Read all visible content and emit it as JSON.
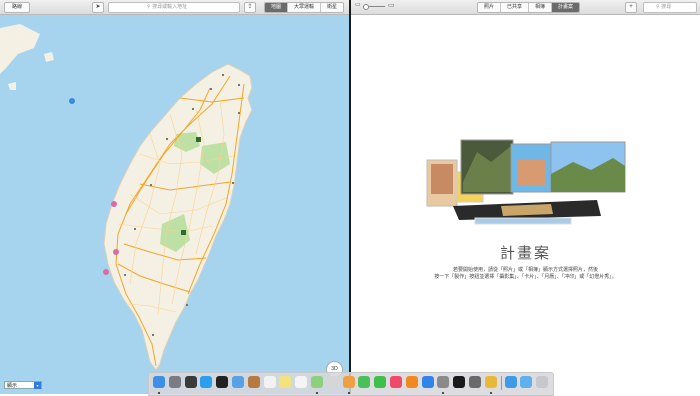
{
  "maps": {
    "directions_label": "路線",
    "search_placeholder": "搜尋或輸入地址",
    "map_types": [
      "地圖",
      "大眾運輸",
      "衛星"
    ],
    "active_map_type": "地圖",
    "compass_label": "3D",
    "display_select": "顯示"
  },
  "photos": {
    "tabs": [
      "照片",
      "已共享",
      "相簿",
      "計畫案"
    ],
    "active_tab": "計畫案",
    "search_placeholder": "搜尋",
    "projects_title": "計畫案",
    "line1": "若要開始使用，請從「照片」或「相簿」顯示方式選擇照片，然後",
    "line2": "按一下「製作」按鈕並選擇「攝影集」、「卡片」、「月曆」、「冲印」或「幻燈片秀」。"
  },
  "dock": {
    "apps": [
      {
        "icon": "finder-icon",
        "color": "#3d8fe8",
        "running": true
      },
      {
        "icon": "launchpad-icon",
        "color": "#7b7b82",
        "running": false
      },
      {
        "icon": "mission-control-icon",
        "color": "#3a3a3a",
        "running": false
      },
      {
        "icon": "safari-icon",
        "color": "#2b9ef0",
        "running": false
      },
      {
        "icon": "photo-booth-icon",
        "color": "#222222",
        "running": false
      },
      {
        "icon": "mail-icon",
        "color": "#5aa0e6",
        "running": false
      },
      {
        "icon": "contacts-icon",
        "color": "#b77a3e",
        "running": false
      },
      {
        "icon": "calendar-icon",
        "color": "#f2f2f2",
        "running": false
      },
      {
        "icon": "notes-icon",
        "color": "#f6e27a",
        "running": false
      },
      {
        "icon": "reminders-icon",
        "color": "#f4f4f4",
        "running": false
      },
      {
        "icon": "maps-icon",
        "color": "#8dcf7a",
        "running": true
      },
      {
        "icon": "script-editor-icon",
        "color": "#d6d6d6",
        "running": false
      },
      {
        "icon": "photos-icon",
        "color": "#f0a040",
        "running": true
      },
      {
        "icon": "messages-icon",
        "color": "#4bbf5a",
        "running": false
      },
      {
        "icon": "facetime-icon",
        "color": "#3dbf4a",
        "running": false
      },
      {
        "icon": "itunes-icon",
        "color": "#f04a6a",
        "running": false
      },
      {
        "icon": "ibooks-icon",
        "color": "#f08a20",
        "running": false
      },
      {
        "icon": "app-store-icon",
        "color": "#2f86e8",
        "running": false
      },
      {
        "icon": "system-preferences-icon",
        "color": "#8a8a8a",
        "running": true
      },
      {
        "icon": "terminal-icon",
        "color": "#1a1a1a",
        "running": false
      },
      {
        "icon": "preview-icon",
        "color": "#6a6a6a",
        "running": false
      },
      {
        "icon": "chrome-icon",
        "color": "#e8b838",
        "running": true
      },
      {
        "icon": "applications-folder-icon",
        "color": "#3f9ae8",
        "running": false
      },
      {
        "icon": "downloads-folder-icon",
        "color": "#5fb0ee",
        "running": false
      },
      {
        "icon": "trash-icon",
        "color": "#c8c8cc",
        "running": false
      }
    ]
  }
}
